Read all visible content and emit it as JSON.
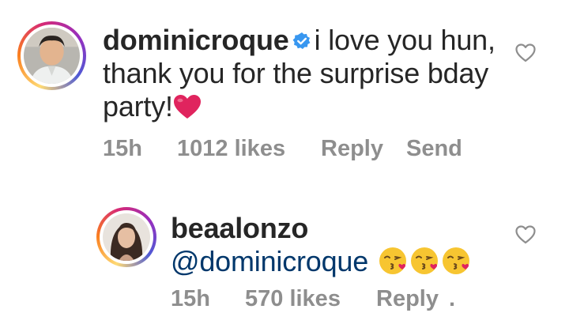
{
  "comments": [
    {
      "username": "dominicroque",
      "verified": true,
      "text": "i love you hun, thank you for the surprise bday party!",
      "emoji": "red-heart",
      "time": "15h",
      "likes": "1012 likes",
      "reply_label": "Reply",
      "send_label": "Send"
    },
    {
      "username": "beaalonzo",
      "mention": "@dominicroque",
      "emoji": [
        "kissing-face",
        "kissing-face",
        "kissing-face"
      ],
      "time": "15h",
      "likes": "570 likes",
      "reply_label": "Reply",
      "extra": "."
    }
  ],
  "icons": {
    "like": "heart-outline-icon",
    "verified": "verified-badge-icon"
  },
  "colors": {
    "text": "#262626",
    "meta": "#8e8e8e",
    "mention": "#00376b",
    "verified": "#3897f0",
    "heart": "#e0245e"
  }
}
